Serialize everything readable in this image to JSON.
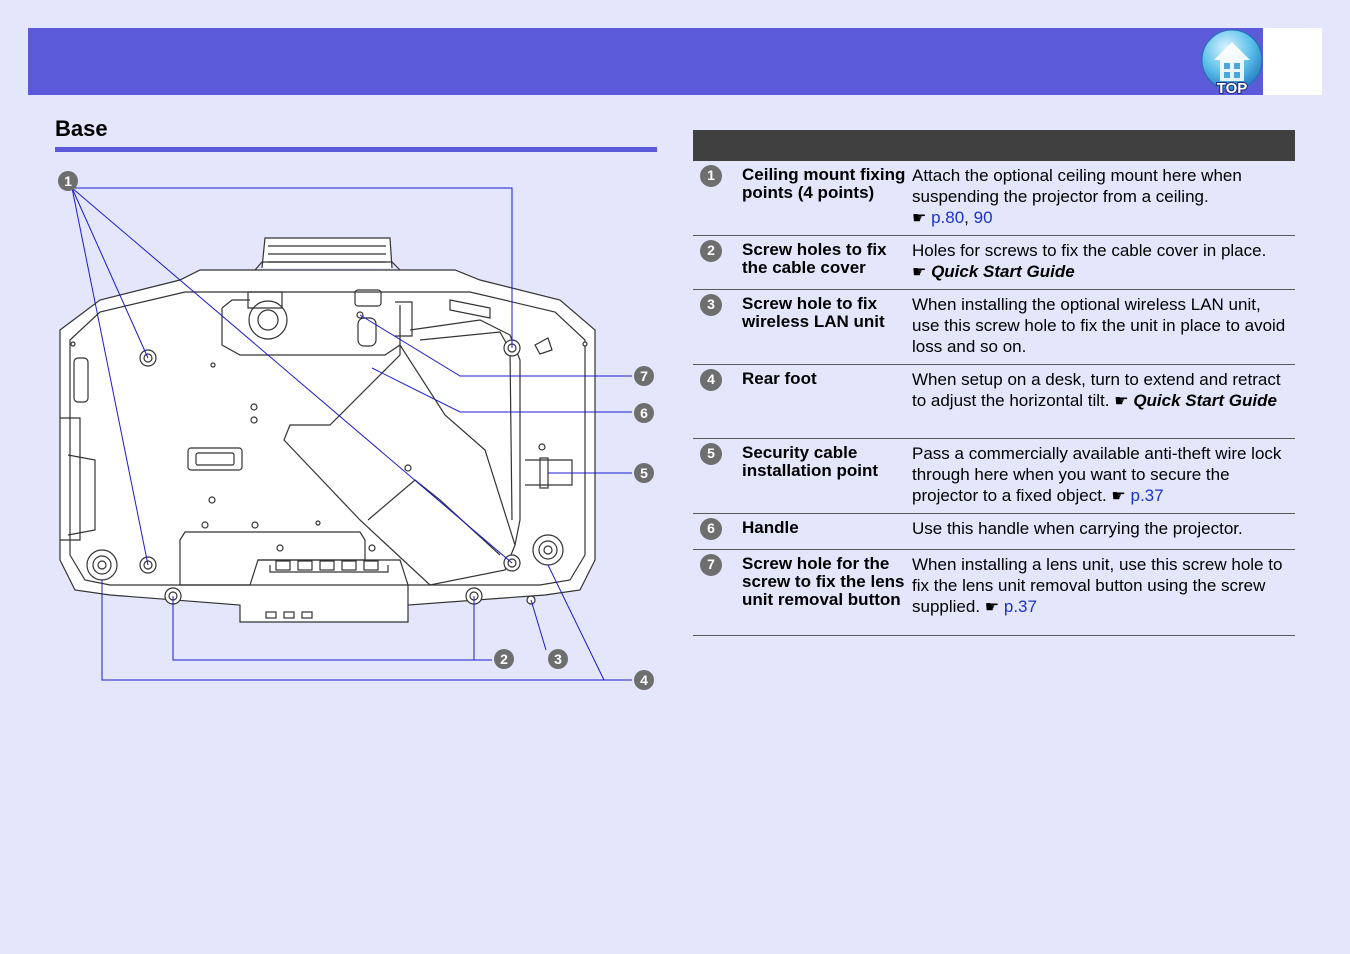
{
  "header": {
    "top_label": "TOP"
  },
  "section": {
    "title": "Base"
  },
  "callouts": [
    "1",
    "2",
    "3",
    "4",
    "5",
    "6",
    "7"
  ],
  "items": [
    {
      "num": "1",
      "name": "Ceiling mount fixing points (4 points)",
      "desc": "Attach the optional ceiling mount here when suspending the projector from a ceiling.",
      "links": [
        "p.80",
        "90"
      ]
    },
    {
      "num": "2",
      "name": "Screw holes to fix the cable cover",
      "desc": "Holes for screws to fix the cable cover in place.",
      "guide": "Quick Start Guide"
    },
    {
      "num": "3",
      "name": "Screw hole to fix wireless LAN unit",
      "desc": "When installing the optional wireless LAN unit, use this screw hole to fix the unit in place to avoid loss and so on."
    },
    {
      "num": "4",
      "name": "Rear foot",
      "desc": "When setup on a desk, turn to extend and retract to adjust the horizontal tilt.",
      "guide": "Quick Start Guide"
    },
    {
      "num": "5",
      "name": "Security cable installation point",
      "desc": "Pass a commercially available anti-theft wire lock through here when you want to secure the projector to a fixed object.",
      "links": [
        "p.37"
      ]
    },
    {
      "num": "6",
      "name": "Handle",
      "desc": "Use this handle when carrying the projector."
    },
    {
      "num": "7",
      "name": "Screw hole for the screw to fix the lens unit removal button",
      "desc": "When installing a lens unit, use this screw hole to fix the lens unit removal button using the screw supplied.",
      "links": [
        "p.37"
      ]
    }
  ],
  "colors": {
    "accent": "#5b5bd9",
    "page_bg": "#e4e6fb",
    "link": "#1a33cc",
    "header_cell": "#404040"
  }
}
